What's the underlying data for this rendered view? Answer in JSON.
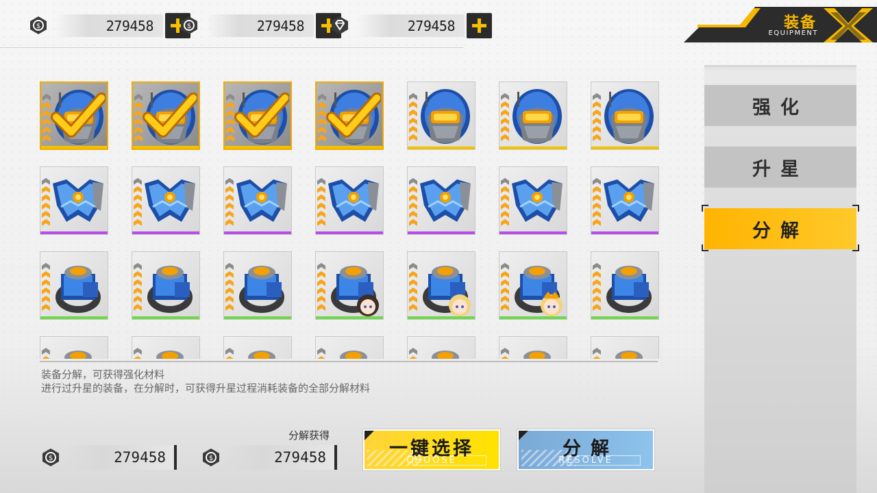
{
  "currencies": [
    {
      "icon": "coin-icon",
      "value": "279458"
    },
    {
      "icon": "coin-icon",
      "value": "279458"
    },
    {
      "icon": "diamond-icon",
      "value": "279458"
    }
  ],
  "header": {
    "title": "装备",
    "subtitle": "EQUIPMENT"
  },
  "tabs": [
    {
      "label": "强化",
      "active": false
    },
    {
      "label": "升星",
      "active": false
    },
    {
      "label": "分解",
      "active": true
    }
  ],
  "grid": {
    "rows": [
      {
        "type": "helmet",
        "rarity_color": "#f2c200",
        "items": [
          {
            "selected": true,
            "stars": 6
          },
          {
            "selected": true,
            "stars": 6
          },
          {
            "selected": true,
            "stars": 6
          },
          {
            "selected": true,
            "stars": 6
          },
          {
            "selected": false,
            "stars": 6
          },
          {
            "selected": false,
            "stars": 6
          },
          {
            "selected": false,
            "stars": 6
          }
        ]
      },
      {
        "type": "armor",
        "rarity_color": "#b84de8",
        "items": [
          {
            "selected": false,
            "stars": 6
          },
          {
            "selected": false,
            "stars": 6
          },
          {
            "selected": false,
            "stars": 6
          },
          {
            "selected": false,
            "stars": 6
          },
          {
            "selected": false,
            "stars": 6
          },
          {
            "selected": false,
            "stars": 6
          },
          {
            "selected": false,
            "stars": 6
          }
        ]
      },
      {
        "type": "ring",
        "rarity_color": "#6fd84a",
        "items": [
          {
            "selected": false,
            "stars": 6
          },
          {
            "selected": false,
            "stars": 6
          },
          {
            "selected": false,
            "stars": 6
          },
          {
            "selected": false,
            "stars": 6,
            "portrait": "character-portrait-dark"
          },
          {
            "selected": false,
            "stars": 6,
            "portrait": "character-portrait-blonde"
          },
          {
            "selected": false,
            "stars": 6,
            "portrait": "character-portrait-crown"
          },
          {
            "selected": false,
            "stars": 6
          }
        ]
      },
      {
        "type": "ring",
        "rarity_color": "#6fd84a",
        "items": [
          {
            "selected": false,
            "stars": 6
          },
          {
            "selected": false,
            "stars": 6
          },
          {
            "selected": false,
            "stars": 6
          },
          {
            "selected": false,
            "stars": 6
          },
          {
            "selected": false,
            "stars": 6
          },
          {
            "selected": false,
            "stars": 6
          },
          {
            "selected": false,
            "stars": 6
          }
        ]
      }
    ]
  },
  "info": {
    "line1": "装备分解，可获得强化材料",
    "line2": "进行过升星的装备，在分解时，可获得升星过程消耗装备的全部分解材料"
  },
  "yield": {
    "label": "分解获得",
    "items": [
      {
        "icon": "coin-icon",
        "value": "279458"
      },
      {
        "icon": "coin-icon",
        "value": "279458"
      }
    ]
  },
  "actions": {
    "choose": {
      "label": "一键选择",
      "sub": "CHOOSE"
    },
    "resolve": {
      "label": "分解",
      "sub": "RESOLVE"
    }
  },
  "colors": {
    "accent": "#ffc000",
    "dark": "#2b2b2b",
    "resolve": "#86b8e4",
    "choose": "#ffd400"
  }
}
